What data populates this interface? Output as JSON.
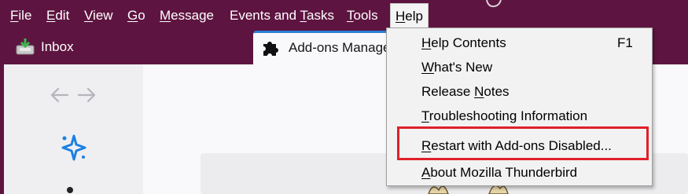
{
  "menubar": {
    "items": [
      {
        "label": "File",
        "access": "F",
        "rest": "ile"
      },
      {
        "label": "Edit",
        "access": "E",
        "rest": "dit"
      },
      {
        "label": "View",
        "access": "V",
        "rest": "iew"
      },
      {
        "label": "Go",
        "access": "G",
        "rest": "o"
      },
      {
        "label": "Message",
        "access": "M",
        "rest": "essage"
      },
      {
        "label": "Events and Tasks",
        "pre": "Events and ",
        "access": "T",
        "rest": "asks"
      },
      {
        "label": "Tools",
        "access": "T",
        "rest": "ools"
      },
      {
        "label": "Help",
        "access": "H",
        "rest": "elp"
      }
    ]
  },
  "tabs": {
    "inbox": {
      "label": "Inbox"
    },
    "addons": {
      "label": "Add-ons Manager"
    }
  },
  "help_menu": {
    "items": [
      {
        "pre": "",
        "access": "H",
        "rest": "elp Contents",
        "shortcut": "F1"
      },
      {
        "pre": "",
        "access": "W",
        "rest": "hat's New",
        "shortcut": ""
      },
      {
        "pre": "Release ",
        "access": "N",
        "rest": "otes",
        "shortcut": ""
      },
      {
        "pre": "",
        "access": "T",
        "rest": "roubleshooting Information",
        "shortcut": ""
      },
      {
        "pre": "",
        "access": "R",
        "rest": "estart with Add-ons Disabled...",
        "shortcut": ""
      },
      {
        "pre": "",
        "access": "A",
        "rest": "bout Mozilla Thunderbird",
        "shortcut": ""
      }
    ],
    "highlighted_item": "Restart with Add-ons Disabled..."
  },
  "colors": {
    "titlebar": "#5e1440",
    "highlight_box": "#e0202a",
    "tab_accent": "#2a7fd4",
    "spark_icon": "#1b7fe3"
  },
  "icons": {
    "inbox": "inbox-tray-icon",
    "addons": "puzzle-piece-icon",
    "back": "arrow-left-icon",
    "forward": "arrow-right-icon",
    "discover": "sparkle-icon"
  }
}
